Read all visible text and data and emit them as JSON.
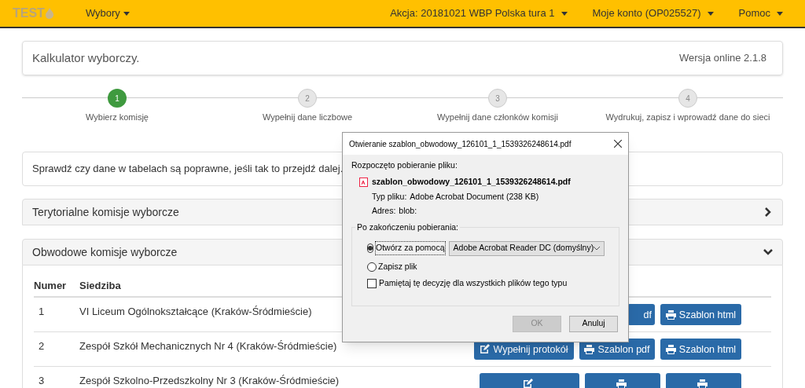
{
  "navbar": {
    "brand": "TEST",
    "menus": [
      {
        "label": "Wybory"
      }
    ],
    "right_menus": [
      {
        "label": "Akcja: 20181021 WBP Polska tura 1"
      },
      {
        "label": "Moje konto (OP025527)"
      },
      {
        "label": "Pomoc"
      }
    ]
  },
  "header": {
    "title": "Kalkulator wyborczy.",
    "version": "Wersja online 2.1.8"
  },
  "steps": [
    {
      "number": "1",
      "label": "Wybierz komisję",
      "selected": true
    },
    {
      "number": "2",
      "label": "Wypełnij dane liczbowe",
      "selected": false
    },
    {
      "number": "3",
      "label": "Wypełnij dane członków komisji",
      "selected": false
    },
    {
      "number": "4",
      "label": "Wydrukuj, zapisz i wprowadź dane do sieci",
      "selected": false
    }
  ],
  "info": "Sprawdź czy dane w tabelach są poprawne, jeśli tak to przejdź dalej.",
  "panels": [
    {
      "title": "Terytorialne komisje wyborcze",
      "expanded": false
    },
    {
      "title": "Obwodowe komisje wyborcze",
      "expanded": true
    }
  ],
  "table": {
    "columns": [
      "Numer",
      "Siedziba"
    ],
    "rows": [
      {
        "number": "1",
        "seat": "VI Liceum Ogólnokształcące (Kraków-Śródmieście)",
        "actions": [
          {
            "kind": "partial",
            "label": "df"
          },
          {
            "kind": "print",
            "label": "Szablon html"
          }
        ]
      },
      {
        "number": "2",
        "seat": "Zespół Szkół Mechanicznych Nr 4 (Kraków-Śródmieście)",
        "actions": [
          {
            "kind": "edit",
            "label": "Wypełnij protokół"
          },
          {
            "kind": "print",
            "label": "Szablon pdf"
          },
          {
            "kind": "print",
            "label": "Szablon html"
          }
        ]
      },
      {
        "number": "3",
        "seat": "Zespół Szkolno-Przedszkolny Nr 3 (Kraków-Śródmieście)",
        "actions": [
          {
            "kind": "edit"
          },
          {
            "kind": "print"
          },
          {
            "kind": "print"
          }
        ]
      }
    ]
  },
  "dialog": {
    "title": "Otwieranie szablon_obwodowy_126101_1_1539326248614.pdf",
    "intro": "Rozpoczęto pobieranie pliku:",
    "file": "szablon_obwodowy_126101_1_1539326248614.pdf",
    "details": [
      {
        "label": "Typ pliku:",
        "value": "Adobe Acrobat Document (238 KB)"
      },
      {
        "label": "Adres:",
        "value": "blob:"
      }
    ],
    "group": "Po zakończeniu pobierania:",
    "options": [
      {
        "label": "Otwórz za pomocą",
        "selected": true
      },
      {
        "label": "Zapisz plik",
        "selected": false
      }
    ],
    "app": "Adobe Acrobat Reader DC  (domyślny)",
    "remember": {
      "label": "Pamiętaj tę decyzję dla wszystkich plików tego typu",
      "checked": false
    },
    "buttons": [
      {
        "label": "OK",
        "disabled": true
      },
      {
        "label": "Anuluj",
        "disabled": false
      }
    ]
  }
}
